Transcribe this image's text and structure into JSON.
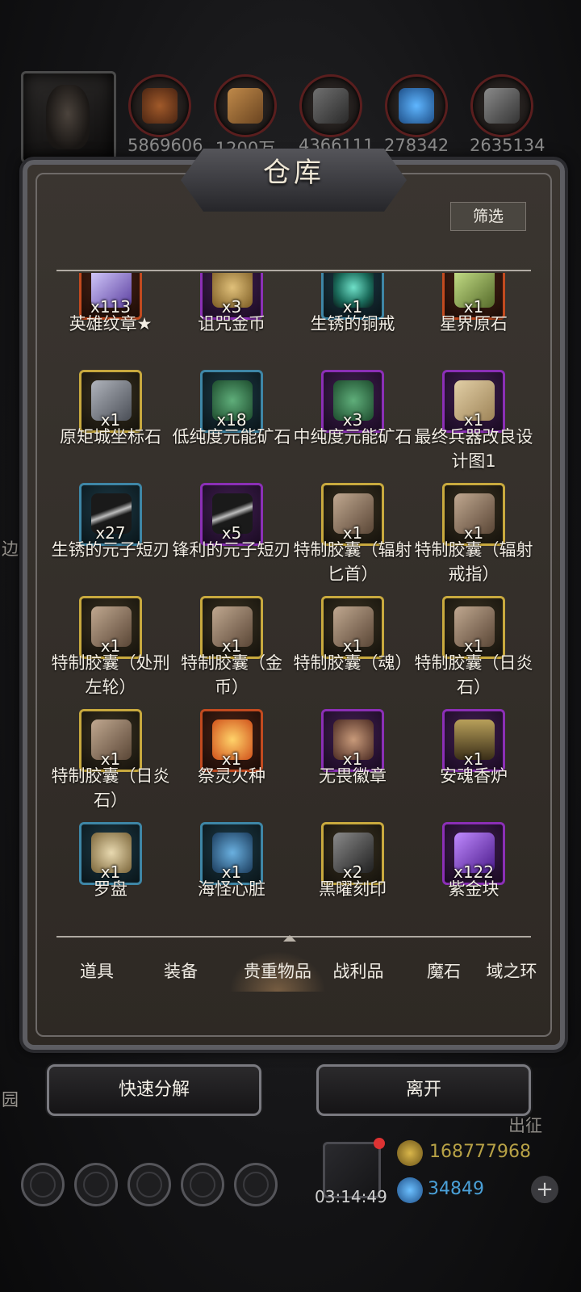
{
  "resources": {
    "values": [
      "5869606",
      "1200万",
      "4366111",
      "278342",
      "2635134"
    ],
    "icons": [
      "leather-icon",
      "wood-icon",
      "ingot-icon",
      "crystal-icon",
      "iron-icon"
    ]
  },
  "panel": {
    "title": "仓库",
    "filter_label": "筛选"
  },
  "items": [
    {
      "name": "英雄纹章★",
      "count": "x113",
      "rarity": "orange",
      "icon": "potion-icon"
    },
    {
      "name": "诅咒金币",
      "count": "x3",
      "rarity": "purple",
      "icon": "coin-icon"
    },
    {
      "name": "生锈的铜戒",
      "count": "x1",
      "rarity": "blue",
      "icon": "ring-icon"
    },
    {
      "name": "星界原石",
      "count": "x1",
      "rarity": "orange",
      "icon": "stone-icon"
    },
    {
      "name": "原矩城坐标石",
      "count": "x1",
      "rarity": "gold",
      "icon": "cube-icon"
    },
    {
      "name": "低纯度元能矿石",
      "count": "x18",
      "rarity": "blue",
      "icon": "ore-icon"
    },
    {
      "name": "中纯度元能矿石",
      "count": "x3",
      "rarity": "purple",
      "icon": "ore-icon"
    },
    {
      "name": "最终兵器改良设计图1",
      "count": "x1",
      "rarity": "purple",
      "icon": "blueprint-icon"
    },
    {
      "name": "生锈的元子短刃",
      "count": "x27",
      "rarity": "blue",
      "icon": "blade-icon"
    },
    {
      "name": "锋利的元子短刃",
      "count": "x5",
      "rarity": "purple",
      "icon": "blade-icon"
    },
    {
      "name": "特制胶囊（辐射匕首）",
      "count": "x1",
      "rarity": "gold",
      "icon": "capsule-icon"
    },
    {
      "name": "特制胶囊（辐射戒指）",
      "count": "x1",
      "rarity": "gold",
      "icon": "capsule-icon"
    },
    {
      "name": "特制胶囊（处刑左轮）",
      "count": "x1",
      "rarity": "gold",
      "icon": "capsule-icon"
    },
    {
      "name": "特制胶囊（金币）",
      "count": "x1",
      "rarity": "gold",
      "icon": "capsule-icon"
    },
    {
      "name": "特制胶囊（魂）",
      "count": "x1",
      "rarity": "gold",
      "icon": "capsule-icon"
    },
    {
      "name": "特制胶囊（日炎石）",
      "count": "x1",
      "rarity": "gold",
      "icon": "capsule-icon"
    },
    {
      "name": "特制胶囊（日炎石）",
      "count": "x1",
      "rarity": "gold",
      "icon": "capsule-icon"
    },
    {
      "name": "祭灵火种",
      "count": "x1",
      "rarity": "orange",
      "icon": "fire-icon"
    },
    {
      "name": "无畏徽章",
      "count": "x1",
      "rarity": "purple",
      "icon": "badge-icon"
    },
    {
      "name": "安魂香炉",
      "count": "x1",
      "rarity": "purple",
      "icon": "censer-icon"
    },
    {
      "name": "罗盘",
      "count": "x1",
      "rarity": "blue",
      "icon": "compass-icon"
    },
    {
      "name": "海怪心脏",
      "count": "x1",
      "rarity": "blue",
      "icon": "heart-icon"
    },
    {
      "name": "黑曜刻印",
      "count": "x2",
      "rarity": "gold",
      "icon": "obsidian-icon"
    },
    {
      "name": "紫金块",
      "count": "x122",
      "rarity": "purple",
      "icon": "amethyst-icon"
    }
  ],
  "tabs": [
    "道具",
    "装备",
    "贵重物品",
    "战利品",
    "魔石",
    "域之环"
  ],
  "active_tab": "贵重物品",
  "buttons": {
    "decompose": "快速分解",
    "leave": "离开"
  },
  "background": {
    "left_texts": [
      "边",
      "园"
    ],
    "right_text": "出征",
    "timer": "03:14:49",
    "gold": "168777968",
    "gems": "34849"
  },
  "colors": {
    "gold_text": "#b8a246",
    "gem_text": "#4aa0d8",
    "accent_red": "#d33333"
  }
}
